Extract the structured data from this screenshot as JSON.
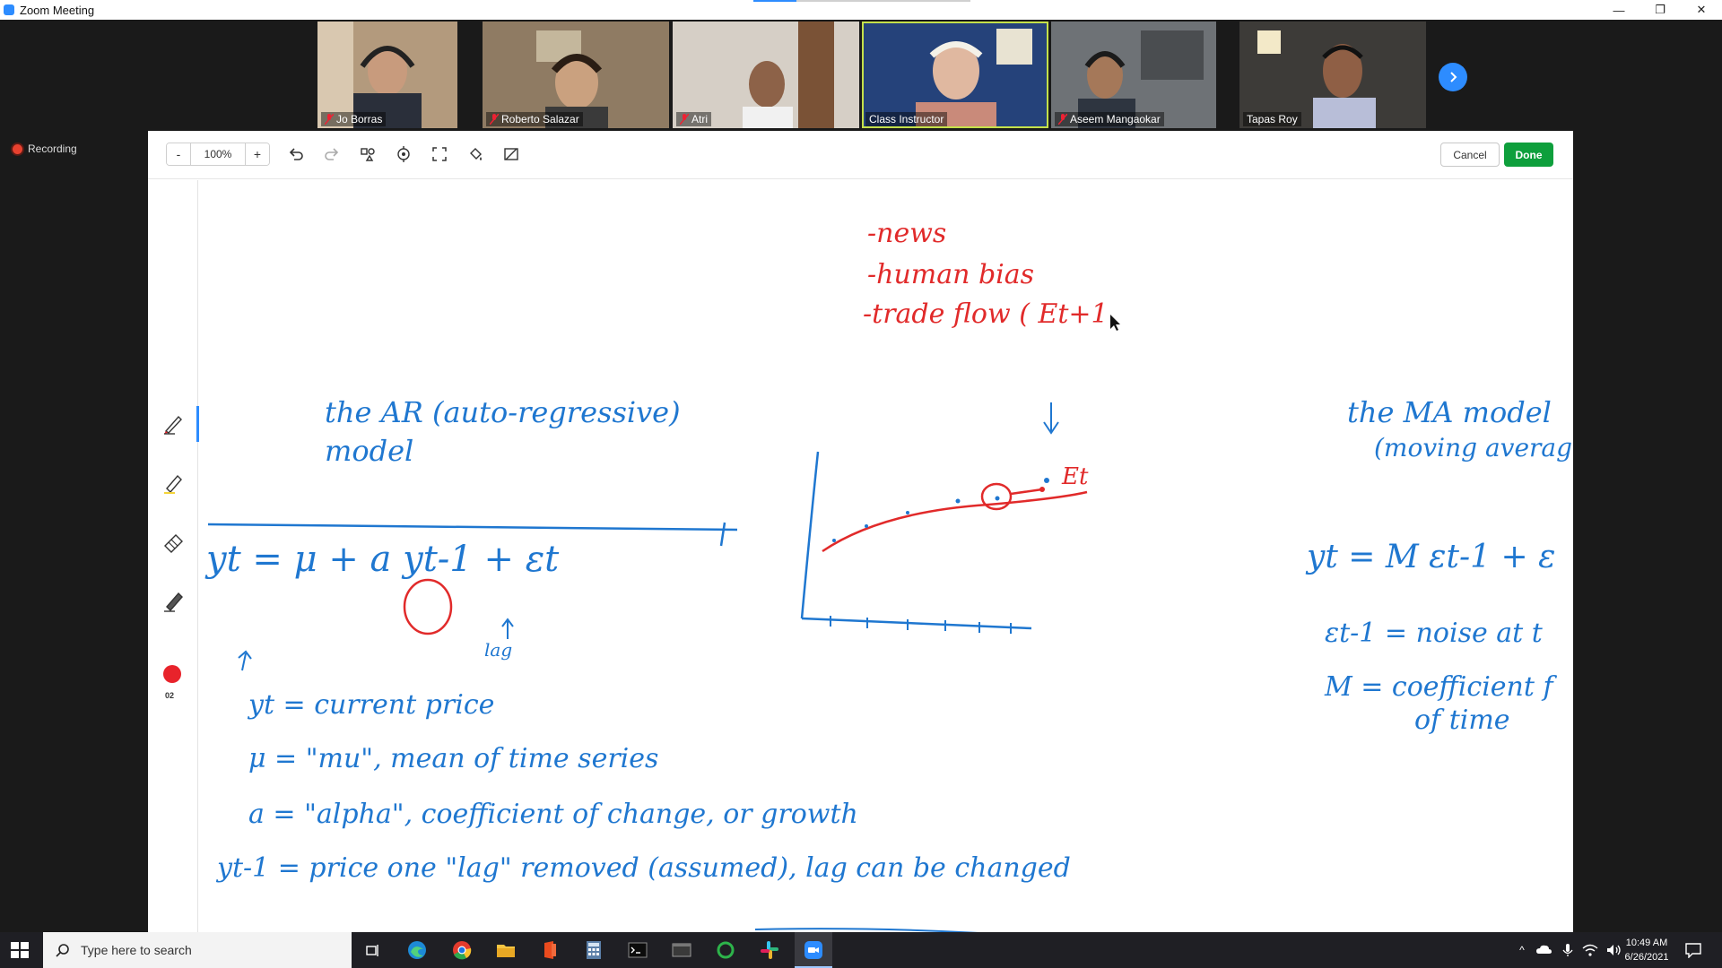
{
  "window": {
    "title": "Zoom Meeting"
  },
  "participants": [
    {
      "name": "Jo Borras",
      "muted": true
    },
    {
      "name": "Roberto Salazar",
      "muted": true
    },
    {
      "name": "Atri",
      "muted": true
    },
    {
      "name": "Class Instructor",
      "muted": false,
      "active": true
    },
    {
      "name": "Aseem Mangaokar",
      "muted": true
    },
    {
      "name": "Tapas Roy",
      "muted": false
    }
  ],
  "recording_label": "Recording",
  "toolbar": {
    "zoom_out": "-",
    "zoom_value": "100%",
    "zoom_in": "+",
    "cancel_label": "Cancel",
    "done_label": "Done"
  },
  "sidebar": {
    "pen_size": "02",
    "pen_color": "#e8232b"
  },
  "whiteboard": {
    "factors": [
      "-news",
      "-human bias",
      "-trade flow ( Et+1"
    ],
    "ar_title_line1": "the AR (auto-regressive)",
    "ar_title_line2": "model",
    "ar_equation": "yt = μ + a yt-1 + εt",
    "lag_note": "lag",
    "definitions": [
      "yt = current price",
      "μ = \"mu\", mean of time series",
      "a = \"alpha\", coefficient of change, or growth",
      "yt-1 = price one \"lag\" removed (assumed), lag can be changed"
    ],
    "graph_label": "Et",
    "ma_title_line1": "the MA model",
    "ma_title_line2": "(moving average",
    "ma_equation": "yt = M εt-1 + ε",
    "ma_definitions": [
      "εt-1 = noise at t",
      "M = coefficient f",
      "of time"
    ],
    "ink_colors": {
      "blue": "#1f77d0",
      "red": "#e12a2a"
    }
  },
  "taskbar": {
    "search_placeholder": "Type here to search",
    "time": "10:49 AM",
    "date": "6/26/2021"
  }
}
